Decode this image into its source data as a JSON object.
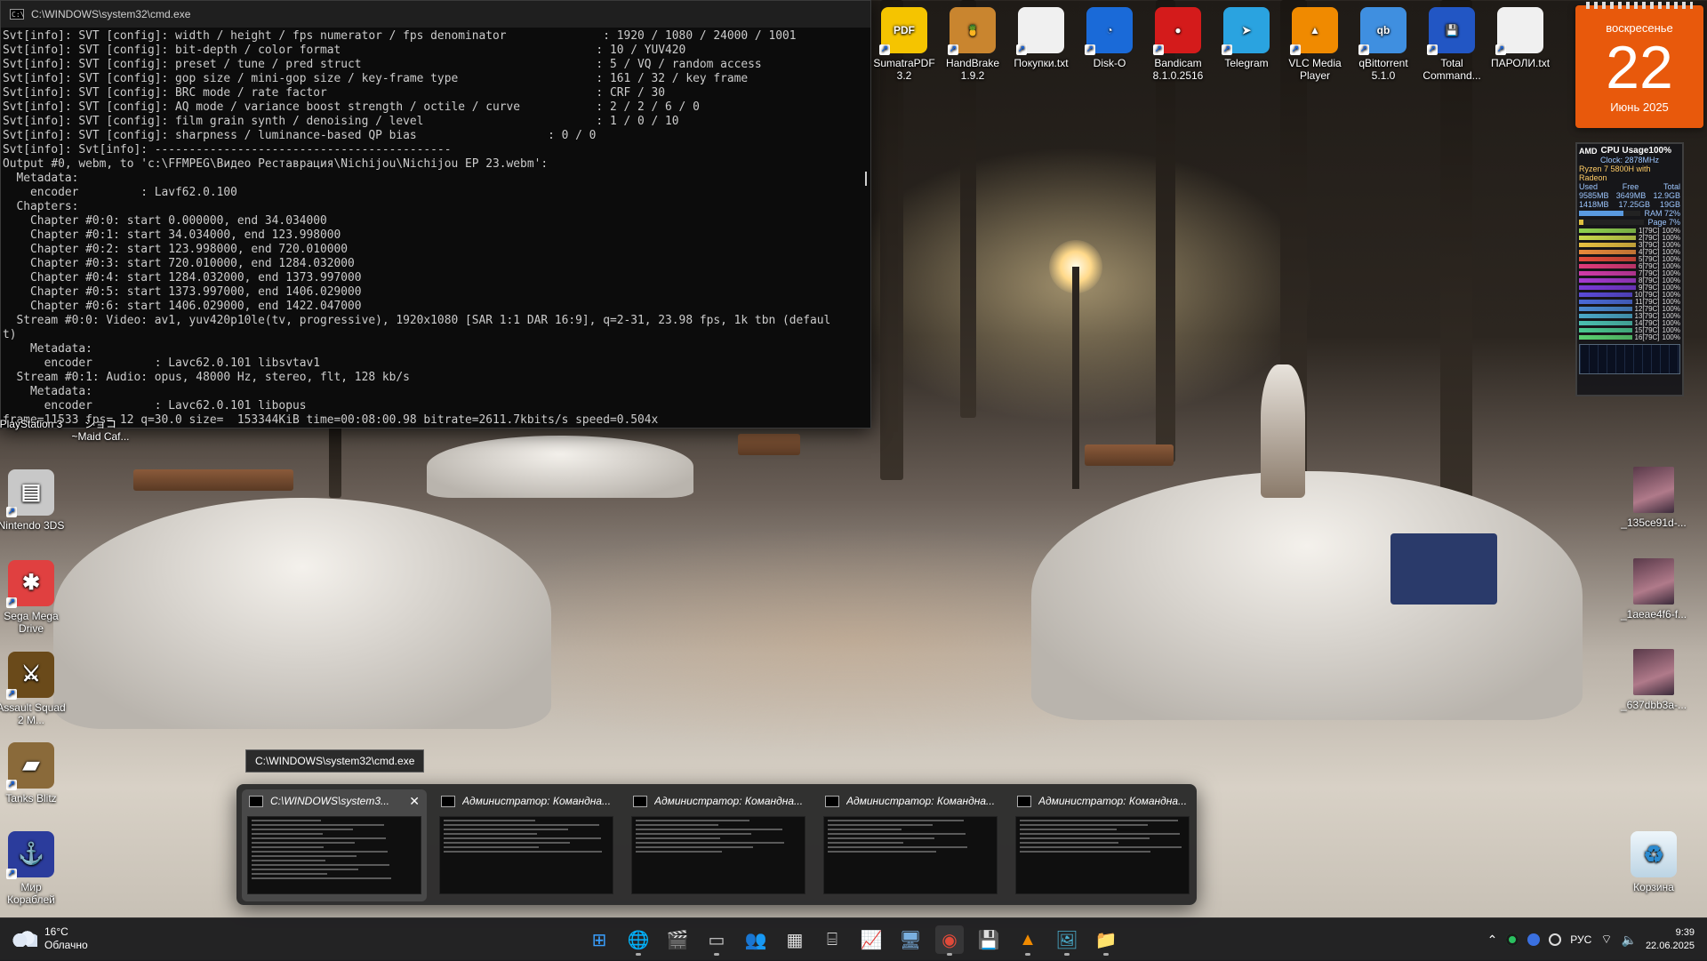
{
  "cmd": {
    "title": "C:\\WINDOWS\\system32\\cmd.exe",
    "lines": [
      "Svt[info]: SVT [config]: width / height / fps numerator / fps denominator              : 1920 / 1080 / 24000 / 1001",
      "Svt[info]: SVT [config]: bit-depth / color format                                     : 10 / YUV420",
      "Svt[info]: SVT [config]: preset / tune / pred struct                                  : 5 / VQ / random access",
      "Svt[info]: SVT [config]: gop size / mini-gop size / key-frame type                    : 161 / 32 / key frame",
      "Svt[info]: SVT [config]: BRC mode / rate factor                                       : CRF / 30",
      "Svt[info]: SVT [config]: AQ mode / variance boost strength / octile / curve           : 2 / 2 / 6 / 0",
      "Svt[info]: SVT [config]: film grain synth / denoising / level                         : 1 / 0 / 10",
      "Svt[info]: SVT [config]: sharpness / luminance-based QP bias                   : 0 / 0",
      "Svt[info]: Svt[info]: -------------------------------------------",
      "Output #0, webm, to 'c:\\FFMPEG\\Видео Реставрация\\Nichijou\\Nichijou EP 23.webm':",
      "  Metadata:",
      "    encoder         : Lavf62.0.100",
      "  Chapters:",
      "    Chapter #0:0: start 0.000000, end 34.034000",
      "    Chapter #0:1: start 34.034000, end 123.998000",
      "    Chapter #0:2: start 123.998000, end 720.010000",
      "    Chapter #0:3: start 720.010000, end 1284.032000",
      "    Chapter #0:4: start 1284.032000, end 1373.997000",
      "    Chapter #0:5: start 1373.997000, end 1406.029000",
      "    Chapter #0:6: start 1406.029000, end 1422.047000",
      "  Stream #0:0: Video: av1, yuv420p10le(tv, progressive), 1920x1080 [SAR 1:1 DAR 16:9], q=2-31, 23.98 fps, 1k tbn (defaul",
      "t)",
      "    Metadata:",
      "      encoder         : Lavc62.0.101 libsvtav1",
      "  Stream #0:1: Audio: opus, 48000 Hz, stereo, flt, 128 kb/s",
      "    Metadata:",
      "      encoder         : Lavc62.0.101 libopus",
      "frame=11533 fps= 12 q=30.0 size=  153344KiB time=00:08:00.98 bitrate=2611.7kbits/s speed=0.504x"
    ]
  },
  "desktop_top": [
    {
      "name": "sumatrapdf",
      "label": "SumatraPDF 3.2",
      "icon": "pdf-icon",
      "color": "#f5c400",
      "glyph": "PDF"
    },
    {
      "name": "handbrake",
      "label": "HandBrake 1.9.2",
      "icon": "pineapple-icon",
      "color": "#c9852f",
      "glyph": "🍍"
    },
    {
      "name": "pokupki",
      "label": "Покупки.txt",
      "icon": "text-file-icon",
      "color": "#f0f0f0",
      "glyph": ""
    },
    {
      "name": "disk-o",
      "label": "Disk-O",
      "icon": "disk-o-icon",
      "color": "#1a6ad8",
      "glyph": "◔"
    },
    {
      "name": "bandicam",
      "label": "Bandicam 8.1.0.2516",
      "icon": "record-icon",
      "color": "#d41b1b",
      "glyph": "●"
    },
    {
      "name": "telegram",
      "label": "Telegram",
      "icon": "telegram-icon",
      "color": "#2aa3e0",
      "glyph": "➤"
    },
    {
      "name": "vlc",
      "label": "VLC Media Player",
      "icon": "vlc-cone-icon",
      "color": "#f08a00",
      "glyph": "▲"
    },
    {
      "name": "qbittorrent",
      "label": "qBittorrent 5.1.0",
      "icon": "qbittorrent-icon",
      "color": "#3f8fe0",
      "glyph": "qb"
    },
    {
      "name": "total-commander",
      "label": "Total Command...",
      "icon": "floppy-icon",
      "color": "#2256c4",
      "glyph": "💾"
    },
    {
      "name": "paroli",
      "label": "ПАРОЛИ.txt",
      "icon": "text-file-icon",
      "color": "#f0f0f0",
      "glyph": ""
    }
  ],
  "desktop_left": [
    {
      "name": "playstation3",
      "label": "PlayStation 3",
      "icon": "ps3-icon"
    },
    {
      "name": "maid-cafe",
      "label": "~Maid Caf...",
      "icon": "game-icon",
      "sublabel": "ショコ"
    },
    {
      "name": "nintendo-3ds",
      "label": "Nintendo 3DS",
      "icon": "3ds-icon",
      "color": "#c8c8c8",
      "glyph": "▤"
    },
    {
      "name": "sega-mega-drive",
      "label": "Sega Mega Drive",
      "icon": "sega-icon",
      "color": "#e04040",
      "glyph": "✱"
    },
    {
      "name": "assault-squad",
      "label": "Assault Squad 2 M...",
      "icon": "assault-squad-icon",
      "color": "#6a4a1a",
      "glyph": "⚔"
    },
    {
      "name": "tanks-blitz",
      "label": "Tanks Blitz",
      "icon": "tank-icon",
      "color": "#8a6a3a",
      "glyph": "▰"
    },
    {
      "name": "mir-korabley",
      "label": "Мир Кораблей",
      "icon": "mir-korabley-icon",
      "color": "#2b3c9c",
      "glyph": "⚓"
    }
  ],
  "desktop_right": [
    {
      "name": "img-135ce",
      "label": "_135ce91d-...",
      "icon": "image-thumbnail-icon"
    },
    {
      "name": "img-1aeae",
      "label": "_1aeae4f6-f...",
      "icon": "image-thumbnail-icon"
    },
    {
      "name": "img-637db",
      "label": "_637dbb3a-...",
      "icon": "image-thumbnail-icon"
    },
    {
      "name": "recycle-bin",
      "label": "Корзина",
      "icon": "recycle-bin-icon"
    }
  ],
  "calendar": {
    "weekday": "воскресенье",
    "day": "22",
    "month": "Июнь 2025"
  },
  "cpu_gadget": {
    "brand": "AMD",
    "title": "CPU Usage100%",
    "clock": "Clock: 2878MHz",
    "model": "Ryzen 7 5800H with Radeon",
    "mem_headers": [
      "Used",
      "Free",
      "Total"
    ],
    "mem_row1": [
      "9585MB",
      "3649MB",
      "12.9GB"
    ],
    "mem_row2": [
      "1418MB",
      "17.25GB",
      "19GB"
    ],
    "ram_label": "RAM",
    "ram_value": "72%",
    "ram_fraction": 0.72,
    "page_label": "Page",
    "page_value": "7%",
    "page_fraction": 0.07,
    "cores": [
      {
        "label": "1[79C]",
        "value": "100%",
        "color": "#8fd14f"
      },
      {
        "label": "2[79C]",
        "value": "100%",
        "color": "#c8d84a"
      },
      {
        "label": "3[79C]",
        "value": "100%",
        "color": "#e8c040"
      },
      {
        "label": "4[79C]",
        "value": "100%",
        "color": "#e88a3a"
      },
      {
        "label": "5[79C]",
        "value": "100%",
        "color": "#e24a3a"
      },
      {
        "label": "6[79C]",
        "value": "100%",
        "color": "#e03a7a"
      },
      {
        "label": "7[79C]",
        "value": "100%",
        "color": "#d03aa8"
      },
      {
        "label": "8[79C]",
        "value": "100%",
        "color": "#a63ad0"
      },
      {
        "label": "9[79C]",
        "value": "100%",
        "color": "#7a3ad8"
      },
      {
        "label": "10[79C]",
        "value": "100%",
        "color": "#5a4ad8"
      },
      {
        "label": "11[79C]",
        "value": "100%",
        "color": "#4a6ad8"
      },
      {
        "label": "12[79C]",
        "value": "100%",
        "color": "#4a8ad0"
      },
      {
        "label": "13[79C]",
        "value": "100%",
        "color": "#4aa8c8"
      },
      {
        "label": "14[79C]",
        "value": "100%",
        "color": "#4ac0b0"
      },
      {
        "label": "15[79C]",
        "value": "100%",
        "color": "#4ac890"
      },
      {
        "label": "16[79C]",
        "value": "100%",
        "color": "#5ad070"
      }
    ]
  },
  "tooltip": "C:\\WINDOWS\\system32\\cmd.exe",
  "switcher": [
    {
      "title": "C:\\WINDOWS\\system3...",
      "active": true
    },
    {
      "title": "Администратор: Командна...",
      "active": false
    },
    {
      "title": "Администратор: Командна...",
      "active": false
    },
    {
      "title": "Администратор: Командна...",
      "active": false
    },
    {
      "title": "Администратор: Командна...",
      "active": false
    }
  ],
  "weather": {
    "temp": "16°C",
    "condition": "Облачно"
  },
  "taskbar_apps": [
    {
      "name": "start",
      "icon": "windows-logo-icon",
      "color": "#3aa0ff"
    },
    {
      "name": "browser-globe",
      "icon": "globe-icon",
      "color": "#3ab0e0"
    },
    {
      "name": "clapper",
      "icon": "clapperboard-icon",
      "color": "#d0d0d0"
    },
    {
      "name": "terminal",
      "icon": "terminal-icon",
      "color": "#cccccc"
    },
    {
      "name": "people",
      "icon": "people-icon",
      "color": "#6aa0e0"
    },
    {
      "name": "calculator",
      "icon": "calculator-icon",
      "color": "#e0e0e0"
    },
    {
      "name": "usb-safely",
      "icon": "usb-icon",
      "color": "#d0d0d0"
    },
    {
      "name": "task-monitor",
      "icon": "monitor-graph-icon",
      "color": "#7ab0e0"
    },
    {
      "name": "remote-desktop",
      "icon": "remote-desktop-icon",
      "color": "#7ab0e0"
    },
    {
      "name": "chrome",
      "icon": "chrome-icon",
      "color": "#e04a3a"
    },
    {
      "name": "total-commander-tb",
      "icon": "floppy-icon",
      "color": "#2256c4"
    },
    {
      "name": "vlc-tb",
      "icon": "vlc-cone-icon",
      "color": "#f08a00"
    },
    {
      "name": "photos",
      "icon": "photos-icon",
      "color": "#4ab0d0"
    },
    {
      "name": "explorer",
      "icon": "folder-icon",
      "color": "#f0c040"
    }
  ],
  "tray": {
    "language": "РУС",
    "time": "9:39",
    "date": "22.06.2025"
  }
}
